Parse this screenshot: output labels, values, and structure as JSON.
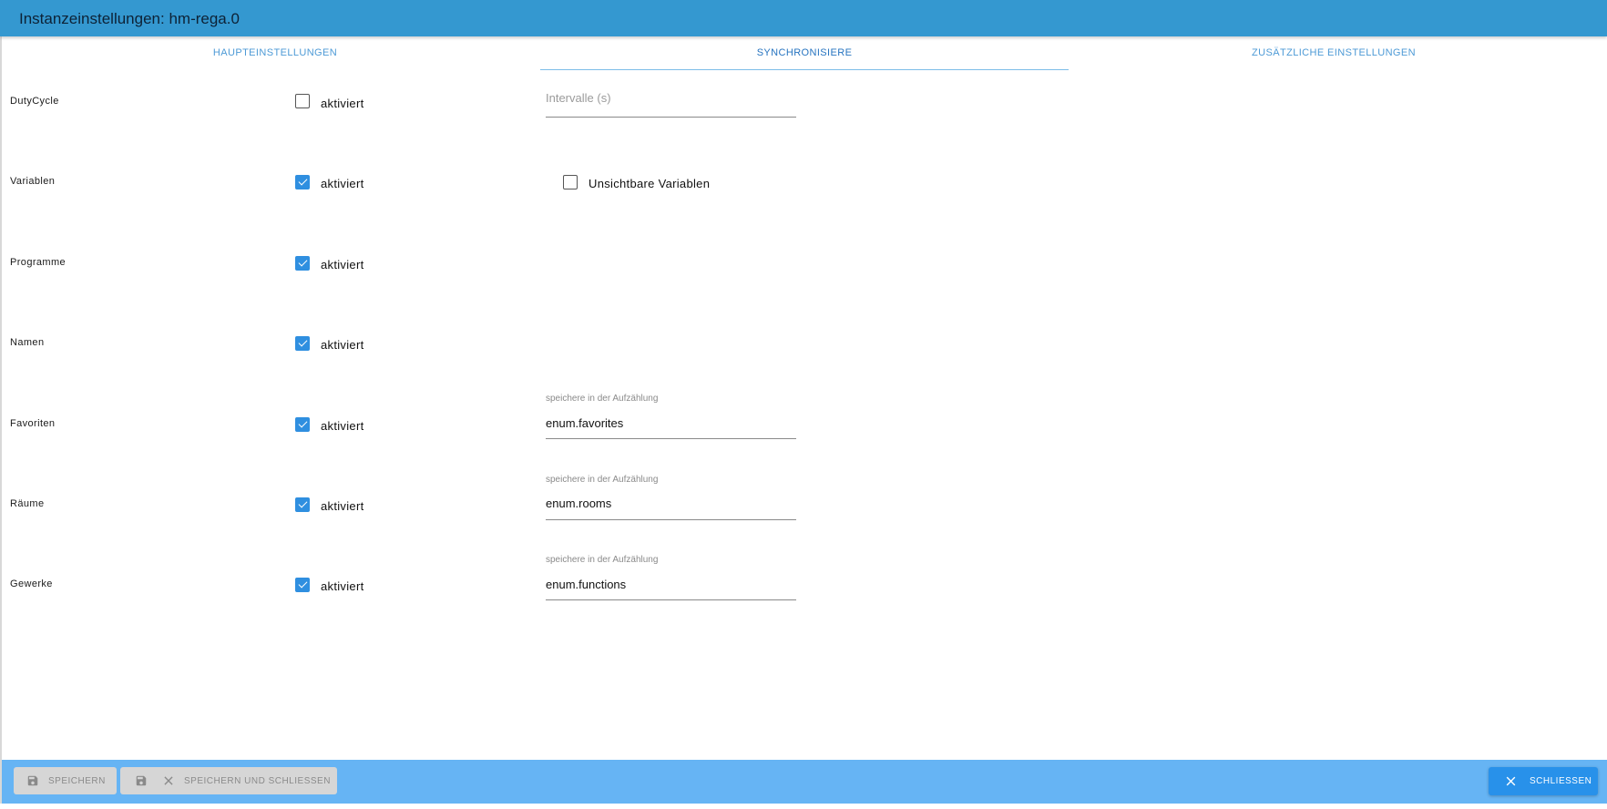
{
  "window": {
    "title": "Instanzeinstellungen: hm-rega.0"
  },
  "tabs": [
    {
      "label": "HAUPTEINSTELLUNGEN"
    },
    {
      "label": "SYNCHRONISIERE"
    },
    {
      "label": "ZUSÄTZLICHE EINSTELLUNGEN"
    }
  ],
  "active_tab": "SYNCHRONISIERE",
  "rows": [
    {
      "label": "DutyCycle",
      "checkbox_label": "aktiviert",
      "checked": false
    },
    {
      "label": "Variablen",
      "checkbox_label": "aktiviert",
      "checked": true
    },
    {
      "label": "Programme",
      "checkbox_label": "aktiviert",
      "checked": true
    },
    {
      "label": "Namen",
      "checkbox_label": "aktiviert",
      "checked": true
    },
    {
      "label": "Favoriten",
      "checkbox_label": "aktiviert",
      "checked": true
    },
    {
      "label": "Räume",
      "checkbox_label": "aktiviert",
      "checked": true
    },
    {
      "label": "Gewerke",
      "checkbox_label": "aktiviert",
      "checked": true
    }
  ],
  "interval_field": {
    "placeholder": "Intervalle (s)",
    "value": ""
  },
  "invisible_vars": {
    "label": "Unsichtbare Variablen",
    "checked": false
  },
  "enum_fields": [
    {
      "caption": "speichere in der Aufzählung",
      "value": "enum.favorites"
    },
    {
      "caption": "speichere in der Aufzählung",
      "value": "enum.rooms"
    },
    {
      "caption": "speichere in der Aufzählung",
      "value": "enum.functions"
    }
  ],
  "footer": {
    "save_label": "SPEICHERN",
    "save_close_label": "SPEICHERN UND SCHLIESSEN",
    "close_label": "SCHLIESSEN"
  },
  "colors": {
    "titlebar": "#3498d0",
    "footer": "#66b4f4",
    "accent": "#2f8fe0",
    "tab_text": "#4d9ad6"
  }
}
